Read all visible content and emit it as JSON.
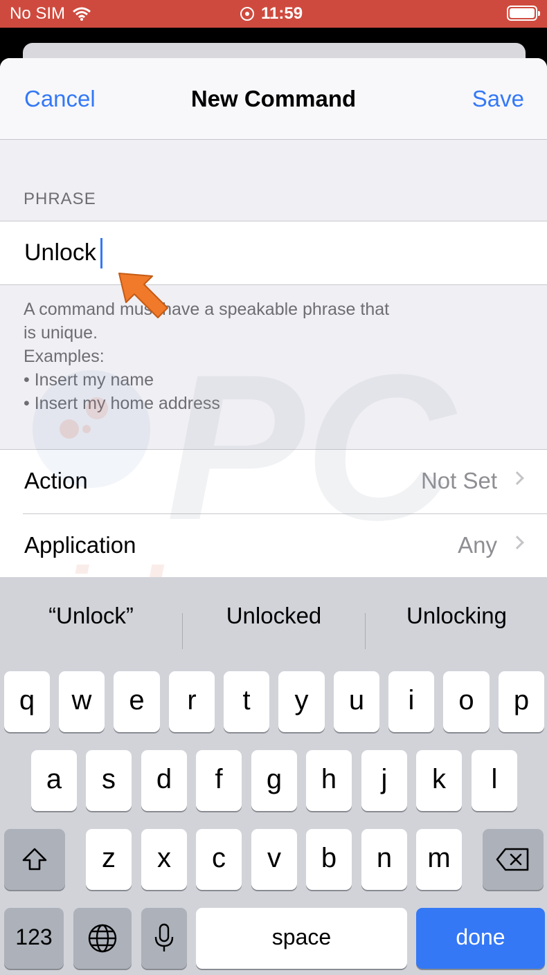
{
  "status_bar": {
    "carrier": "No SIM",
    "time": "11:59"
  },
  "nav": {
    "cancel": "Cancel",
    "title": "New Command",
    "save": "Save"
  },
  "phrase": {
    "header": "PHRASE",
    "value": "Unlock",
    "footer_lines": [
      "A command must have a speakable phrase that",
      "is unique.",
      "Examples:",
      "• Insert my name",
      "• Insert my home address"
    ]
  },
  "rows": [
    {
      "label": "Action",
      "value": "Not Set"
    },
    {
      "label": "Application",
      "value": "Any"
    }
  ],
  "watermark": {
    "text_top": "PC",
    "text_bottom": "risk.com"
  },
  "keyboard": {
    "suggestions": [
      "“Unlock”",
      "Unlocked",
      "Unlocking"
    ],
    "row1": [
      "q",
      "w",
      "e",
      "r",
      "t",
      "y",
      "u",
      "i",
      "o",
      "p"
    ],
    "row2": [
      "a",
      "s",
      "d",
      "f",
      "g",
      "h",
      "j",
      "k",
      "l"
    ],
    "row3": [
      "z",
      "x",
      "c",
      "v",
      "b",
      "n",
      "m"
    ],
    "numbers_key": "123",
    "space_key": "space",
    "done_key": "done"
  },
  "colors": {
    "accent": "#3478f6",
    "status_bar": "#cf4a3e",
    "arrow": "#f07a2a"
  }
}
